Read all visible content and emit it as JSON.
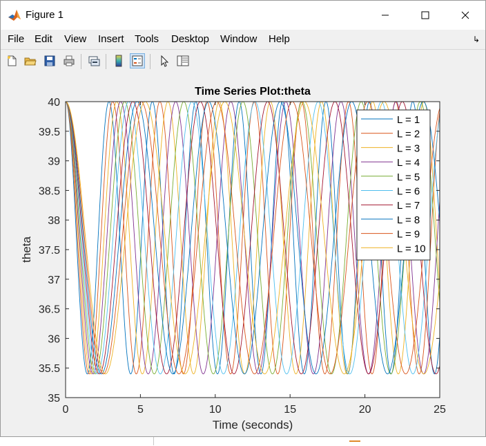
{
  "window": {
    "title": "Figure 1",
    "app_icon": "matlab-icon",
    "controls": [
      "minimize-icon",
      "maximize-icon",
      "close-icon"
    ]
  },
  "menu": {
    "items": [
      "File",
      "Edit",
      "View",
      "Insert",
      "Tools",
      "Desktop",
      "Window",
      "Help"
    ],
    "dock_icon": "dock-arrow-icon"
  },
  "toolbar": {
    "buttons": [
      {
        "name": "new-figure-icon",
        "active": false
      },
      {
        "name": "open-file-icon",
        "active": false
      },
      {
        "name": "save-figure-icon",
        "active": false
      },
      {
        "name": "print-figure-icon",
        "active": false
      },
      {
        "name": "link-plot-icon",
        "active": false
      },
      {
        "name": "insert-colorbar-icon",
        "active": false
      },
      {
        "name": "insert-legend-icon",
        "active": true
      },
      {
        "name": "edit-plot-icon",
        "active": false
      },
      {
        "name": "property-inspector-icon",
        "active": false
      }
    ]
  },
  "chart_data": {
    "type": "line",
    "title": "Time Series Plot:theta",
    "xlabel": "Time (seconds)",
    "ylabel": "theta",
    "xlim": [
      0,
      25
    ],
    "ylim": [
      35,
      40
    ],
    "xticks": [
      0,
      5,
      10,
      15,
      20,
      25
    ],
    "xtick_labels": [
      "0",
      "5",
      "10",
      "15",
      "20",
      "25"
    ],
    "yticks": [
      35,
      35.5,
      36,
      36.5,
      37,
      37.5,
      38,
      38.5,
      39,
      39.5,
      40
    ],
    "ytick_labels": [
      "35",
      "35.5",
      "36",
      "36.5",
      "37",
      "37.5",
      "38",
      "38.5",
      "39",
      "39.5",
      "40"
    ],
    "grid": false,
    "legend_position": "top-right",
    "y_max": 40,
    "y_min": 35.4,
    "series": [
      {
        "name": "L = 1",
        "color": "#0072BD",
        "period": 2.9
      },
      {
        "name": "L = 2",
        "color": "#D95319",
        "period": 3.15
      },
      {
        "name": "L = 3",
        "color": "#EDB120",
        "period": 3.42
      },
      {
        "name": "L = 4",
        "color": "#7E2F8E",
        "period": 3.68
      },
      {
        "name": "L = 5",
        "color": "#77AC30",
        "period": 3.95
      },
      {
        "name": "L = 6",
        "color": "#4DBEEE",
        "period": 4.22
      },
      {
        "name": "L = 7",
        "color": "#A2142F",
        "period": 4.5
      },
      {
        "name": "L = 8",
        "color": "#0072BD",
        "period": 4.78
      },
      {
        "name": "L = 9",
        "color": "#D95319",
        "period": 5.05
      },
      {
        "name": "L = 10",
        "color": "#EDB120",
        "period": 5.32
      }
    ]
  }
}
